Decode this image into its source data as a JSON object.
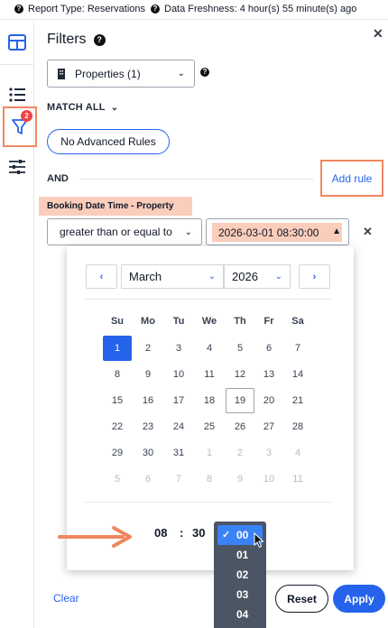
{
  "info_bar": {
    "report_type": "Report Type: Reservations",
    "data_freshness": "Data Freshness: 4 hour(s) 55 minute(s) ago"
  },
  "rail": {
    "filter_badge": "2"
  },
  "panel": {
    "title": "Filters",
    "properties_select": "Properties (1)",
    "match_all": "MATCH ALL",
    "advanced_rules_button": "No Advanced Rules",
    "and_label": "AND",
    "add_rule": "Add rule"
  },
  "rule": {
    "field_label": "Booking Date Time - Property",
    "operator": "greater than or equal to",
    "value": "2026-03-01 08:30:00"
  },
  "calendar": {
    "month": "March",
    "year": "2026",
    "weekdays": [
      "Su",
      "Mo",
      "Tu",
      "We",
      "Th",
      "Fr",
      "Sa"
    ],
    "weeks": [
      [
        "1",
        "2",
        "3",
        "4",
        "5",
        "6",
        "7"
      ],
      [
        "8",
        "9",
        "10",
        "11",
        "12",
        "13",
        "14"
      ],
      [
        "15",
        "16",
        "17",
        "18",
        "19",
        "20",
        "21"
      ],
      [
        "22",
        "23",
        "24",
        "25",
        "26",
        "27",
        "28"
      ],
      [
        "29",
        "30",
        "31",
        "1",
        "2",
        "3",
        "4"
      ],
      [
        "5",
        "6",
        "7",
        "8",
        "9",
        "10",
        "11"
      ]
    ],
    "selected_day": "1",
    "today": "19",
    "time_hour": "08",
    "time_separator": ":",
    "time_minute": "30",
    "minute_options": [
      "00",
      "01",
      "02",
      "03",
      "04"
    ],
    "minute_selected": "00"
  },
  "footer": {
    "clear": "Clear",
    "reset": "Reset",
    "apply": "Apply"
  },
  "colors": {
    "accent": "#2563eb",
    "highlight": "#f0875f",
    "tag_bg": "#fbcdbb",
    "badge": "#ef4444"
  }
}
